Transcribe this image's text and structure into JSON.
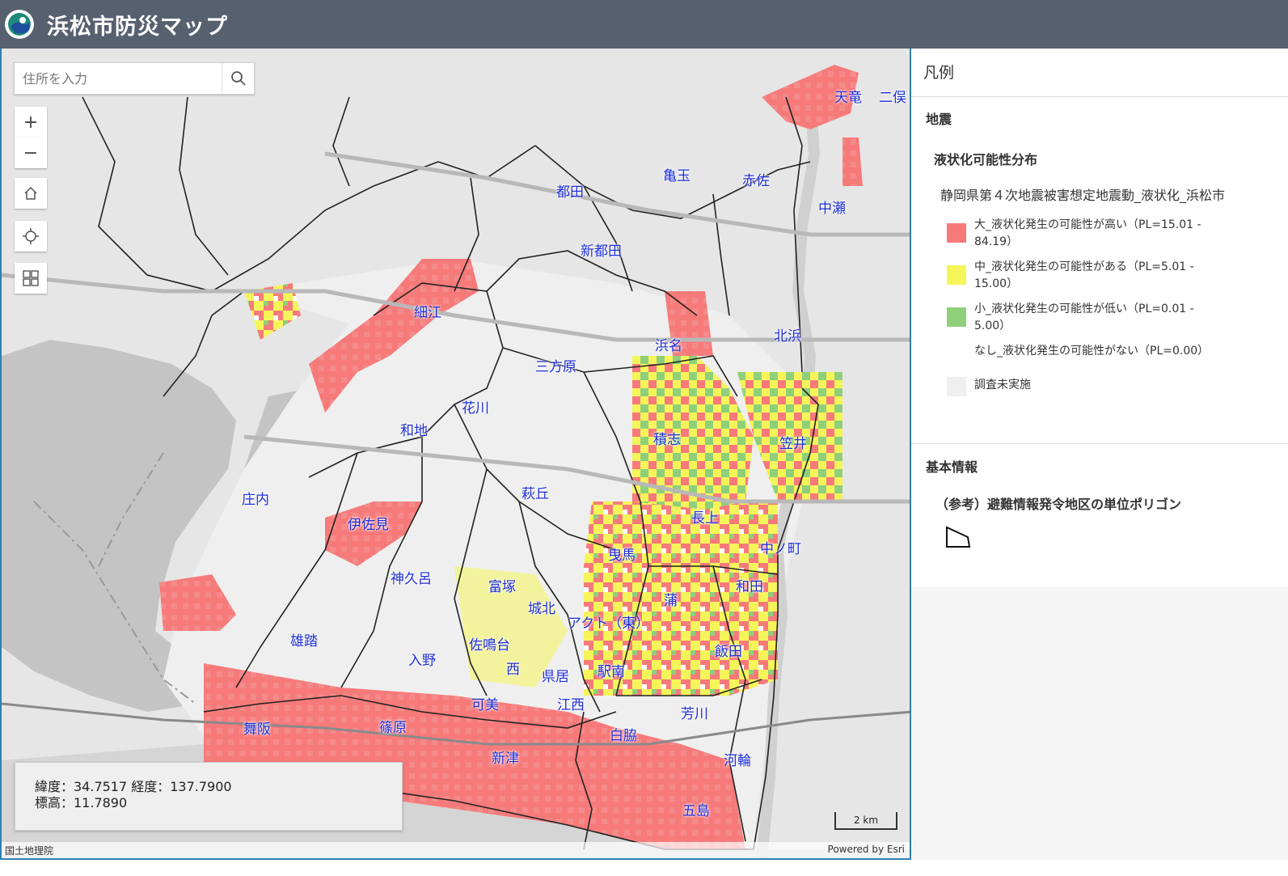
{
  "header": {
    "title": "浜松市防災マップ",
    "logo_icon": "hamamatsu-logo-icon",
    "bg": "#56606f"
  },
  "search": {
    "placeholder": "住所を入力",
    "icon": "search-icon"
  },
  "map_controls": {
    "zoom_in": "+",
    "zoom_out": "−",
    "home_icon": "home-icon",
    "locate_icon": "locate-icon",
    "basemap_icon": "basemap-gallery-icon"
  },
  "coords": {
    "line1": "緯度：34.7517 経度：137.7900",
    "line2": "標高：11.7890"
  },
  "attribution": {
    "left": "国土地理院",
    "right": "Powered by Esri"
  },
  "scalebar": {
    "label": "2 km"
  },
  "places": {
    "tenryu": "天竜",
    "futamata": "二俣",
    "kamedama": "亀玉",
    "akasa": "赤佐",
    "miyakoda": "都田",
    "nakaze": "中瀬",
    "shinmiyakoda": "新都田",
    "hosoe": "細江",
    "hamana": "浜名",
    "kitahama": "北浜",
    "mikatahara": "三方原",
    "hanakawa": "花川",
    "wachi": "和地",
    "sekishi": "積志",
    "kasai": "笠井",
    "shonai": "庄内",
    "hagioka": "萩丘",
    "isami": "伊佐見",
    "nagakami": "長上",
    "nakanomachi": "中ノ町",
    "kamikumae": "神久呂",
    "tomitsuka": "富塚",
    "hikuma": "曳馬",
    "wada": "和田",
    "johoku": "城北",
    "kaba": "蒲",
    "akuto": "アクト（東）",
    "yuto": "雄踏",
    "sanarudai": "佐鳴台",
    "iino": "入野",
    "iida": "飯田",
    "nishi": "西",
    "agata": "県居",
    "ekiminami": "駅南",
    "kami": "可美",
    "enishi": "江西",
    "haga": "芳川",
    "maisaka": "舞阪",
    "shinohara": "篠原",
    "shirawaki": "白脇",
    "shintsu": "新津",
    "kawawa": "河輪",
    "gojima": "五島"
  },
  "legend": {
    "header": "凡例",
    "group_title": "地震",
    "layer_title": "液状化可能性分布",
    "sublayer": "静岡県第４次地震被害想定地震動_液状化_浜松市",
    "items": [
      {
        "label": "大_液状化発生の可能性が高い（PL=15.01 - 84.19）",
        "color": "#f77a7a"
      },
      {
        "label": "中_液状化発生の可能性がある（PL=5.01 - 15.00）",
        "color": "#f5f55a"
      },
      {
        "label": "小_液状化発生の可能性が低い（PL=0.01 - 5.00）",
        "color": "#8fcf7a"
      },
      {
        "label": "なし_液状化発生の可能性がない（PL=0.00）",
        "color": "#ffffff"
      },
      {
        "label": "調査未実施",
        "color": "#efefef"
      }
    ],
    "info_title": "基本情報",
    "polygon_title": "（参考）避難情報発令地区の単位ポリゴン",
    "polygon_icon": "polygon-outline-icon"
  }
}
